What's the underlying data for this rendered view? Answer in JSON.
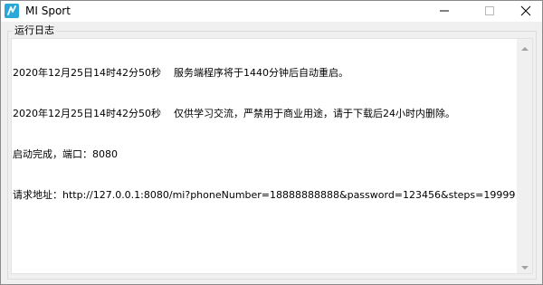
{
  "window": {
    "title": "MI Sport",
    "icon": "mi-sport-app-icon"
  },
  "controls": {
    "minimize_icon": "minimize-icon",
    "maximize_icon": "maximize-icon",
    "close_icon": "close-icon"
  },
  "log_panel": {
    "label": "运行日志",
    "lines": [
      "2020年12月25日14时42分50秒    服务端程序将于1440分钟后自动重启。",
      "2020年12月25日14时42分50秒    仅供学习交流，严禁用于商业用途，请于下载后24小时内删除。",
      "启动完成，端口：8080",
      "请求地址：http://127.0.0.1:8080/mi?phoneNumber=18888888888&password=123456&steps=19999"
    ]
  },
  "colors": {
    "app_icon": "#2aa8d8",
    "titlebar": "#ffffff",
    "window_bg": "#f0f0f0"
  }
}
